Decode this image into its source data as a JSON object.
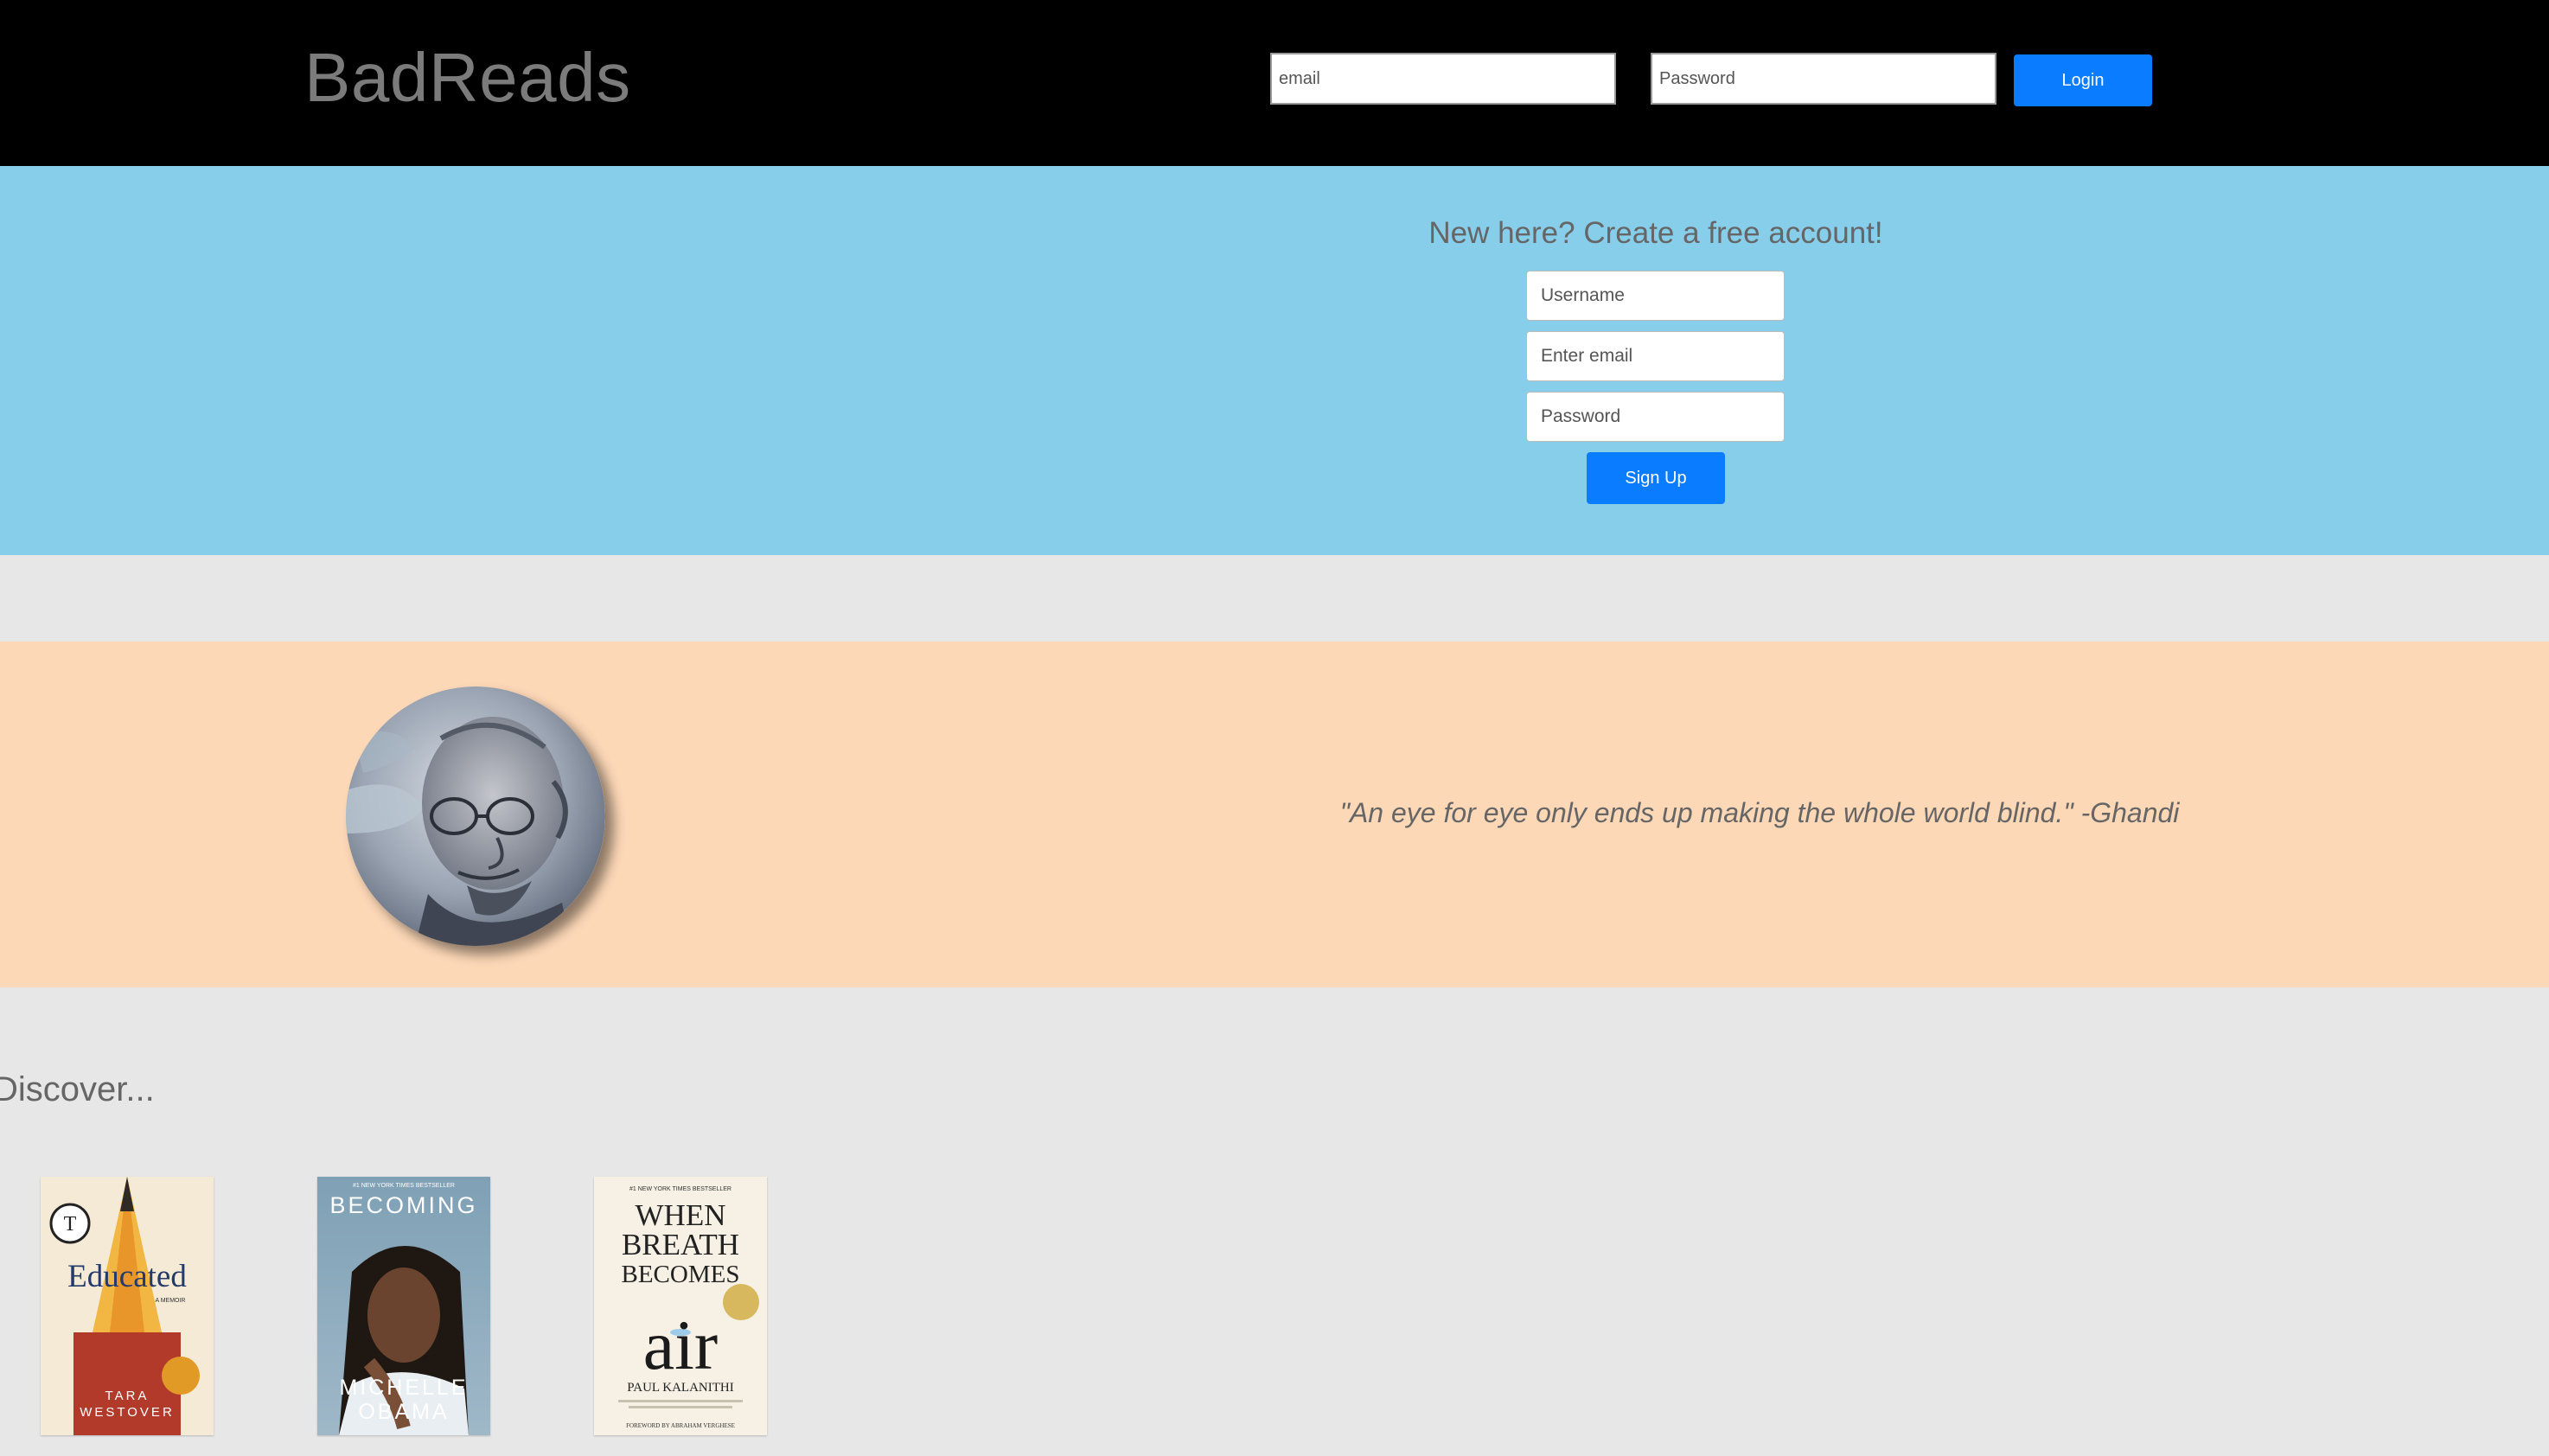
{
  "header": {
    "brand": "BadReads",
    "email_placeholder": "email",
    "password_placeholder": "Password",
    "login_label": "Login"
  },
  "signup": {
    "title": "New here? Create a free account!",
    "username_placeholder": "Username",
    "email_placeholder": "Enter email",
    "password_placeholder": "Password",
    "button_label": "Sign Up"
  },
  "quote": {
    "text": "\"An eye for eye only ends up making the whole world blind.\" -Ghandi"
  },
  "discover": {
    "title": "Discover...",
    "books": [
      {
        "title": "Educated",
        "subtitle": "A MEMOIR",
        "author_line1": "TARA",
        "author_line2": "WESTOVER",
        "top_text": ""
      },
      {
        "title": "BECOMING",
        "subtitle": "",
        "author_line1": "MICHELLE",
        "author_line2": "OBAMA",
        "top_text": "#1 NEW YORK TIMES BESTSELLER"
      },
      {
        "title_line1": "WHEN",
        "title_line2": "BREATH",
        "title_line3": "BECOMES",
        "title_line4": "air",
        "author_line1": "PAUL KALANITHI",
        "author_line2": "",
        "top_text": "#1 NEW YORK TIMES BESTSELLER",
        "footer": "FOREWORD BY ABRAHAM VERGHESE"
      }
    ]
  },
  "colors": {
    "topbar": "#000000",
    "signup_band": "#87ceeb",
    "quote_band": "#fdd8b7",
    "page_bg": "#e7e7e7",
    "button": "#0a7cff"
  }
}
